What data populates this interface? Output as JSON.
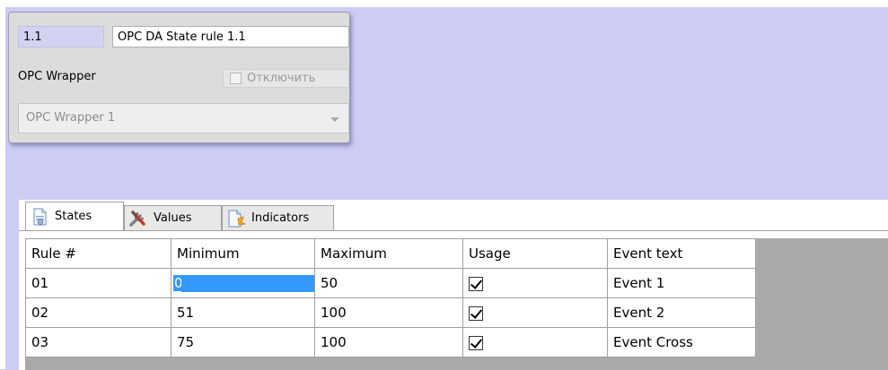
{
  "panel": {
    "id_value": "1.1",
    "name_value": "OPC DA State rule 1.1",
    "wrapper_label": "OPC Wrapper",
    "disable_label": "Отключить",
    "disable_checked": false,
    "wrapper_selected": "OPC Wrapper 1"
  },
  "tabs": [
    {
      "label": "States",
      "icon": "states-doc-icon",
      "active": true
    },
    {
      "label": "Values",
      "icon": "tools-icon",
      "active": false
    },
    {
      "label": "Indicators",
      "icon": "indicators-doc-icon",
      "active": false
    }
  ],
  "grid": {
    "columns": [
      "Rule #",
      "Minimum",
      "Maximum",
      "Usage",
      "Event text"
    ],
    "rows": [
      {
        "rule": "01",
        "min": "0",
        "max": "50",
        "usage": true,
        "event": "Event 1"
      },
      {
        "rule": "02",
        "min": "51",
        "max": "100",
        "usage": true,
        "event": "Event 2"
      },
      {
        "rule": "03",
        "min": "75",
        "max": "100",
        "usage": true,
        "event": "Event Cross"
      }
    ]
  },
  "colors": {
    "background": "#ccccf5",
    "selection": "#3399ff"
  }
}
